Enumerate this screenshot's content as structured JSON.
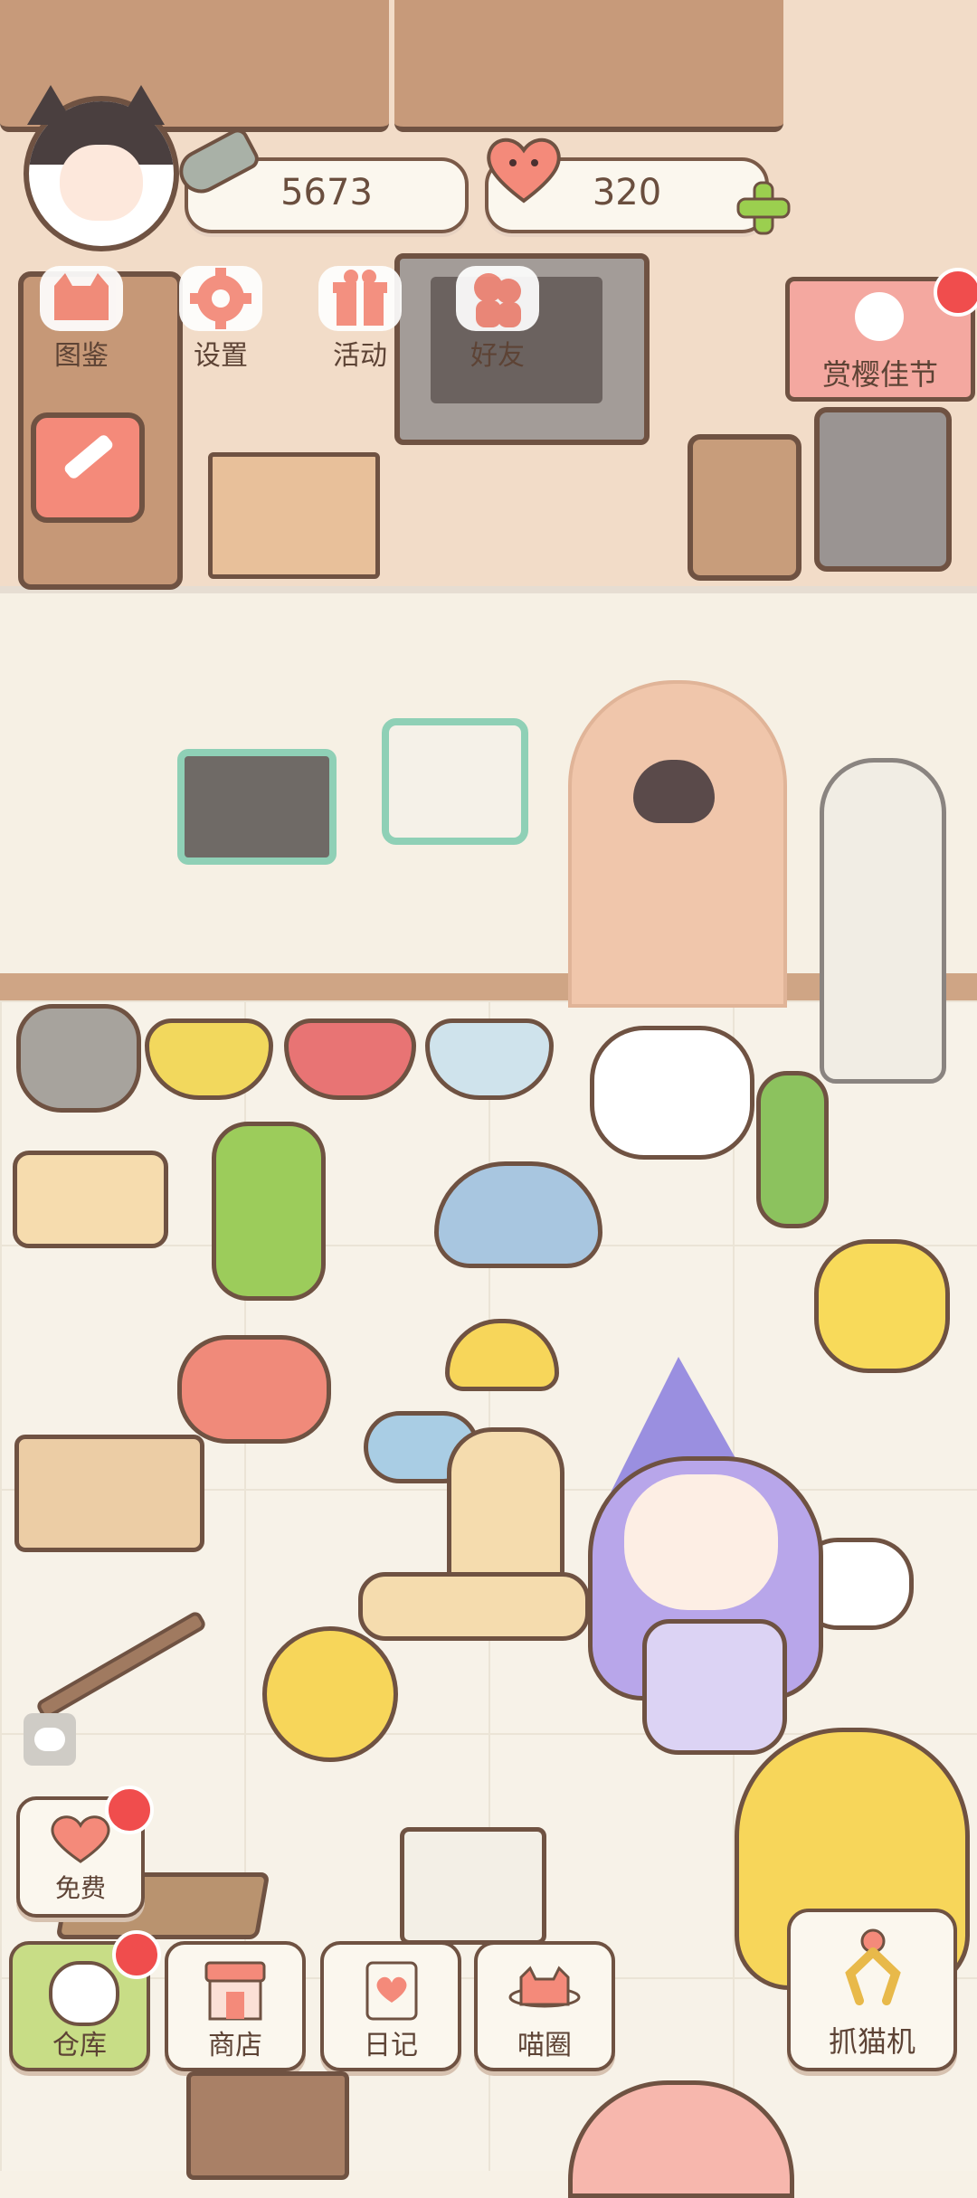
{
  "hud": {
    "coins": "5673",
    "hearts": "320"
  },
  "menu": [
    {
      "label": "图鉴",
      "icon": "cat-book-icon"
    },
    {
      "label": "设置",
      "icon": "gear-icon"
    },
    {
      "label": "活动",
      "icon": "gift-icon"
    },
    {
      "label": "好友",
      "icon": "friends-icon"
    }
  ],
  "event_banner": {
    "label": "赏樱佳节"
  },
  "bottom_nav": [
    {
      "label": "仓库",
      "icon": "storage-icon"
    },
    {
      "label": "商店",
      "icon": "shop-icon"
    },
    {
      "label": "日记",
      "icon": "diary-icon"
    },
    {
      "label": "喵圈",
      "icon": "planet-cat-icon"
    }
  ],
  "free_button": {
    "label": "免费"
  },
  "catch_machine": {
    "label": "抓猫机"
  },
  "colors": {
    "accent_red": "#f04d4d",
    "salmon": "#f48a7a",
    "outline": "#6f5242",
    "green_plus": "#9bcf4f",
    "storage_green": "#c8dd86"
  }
}
